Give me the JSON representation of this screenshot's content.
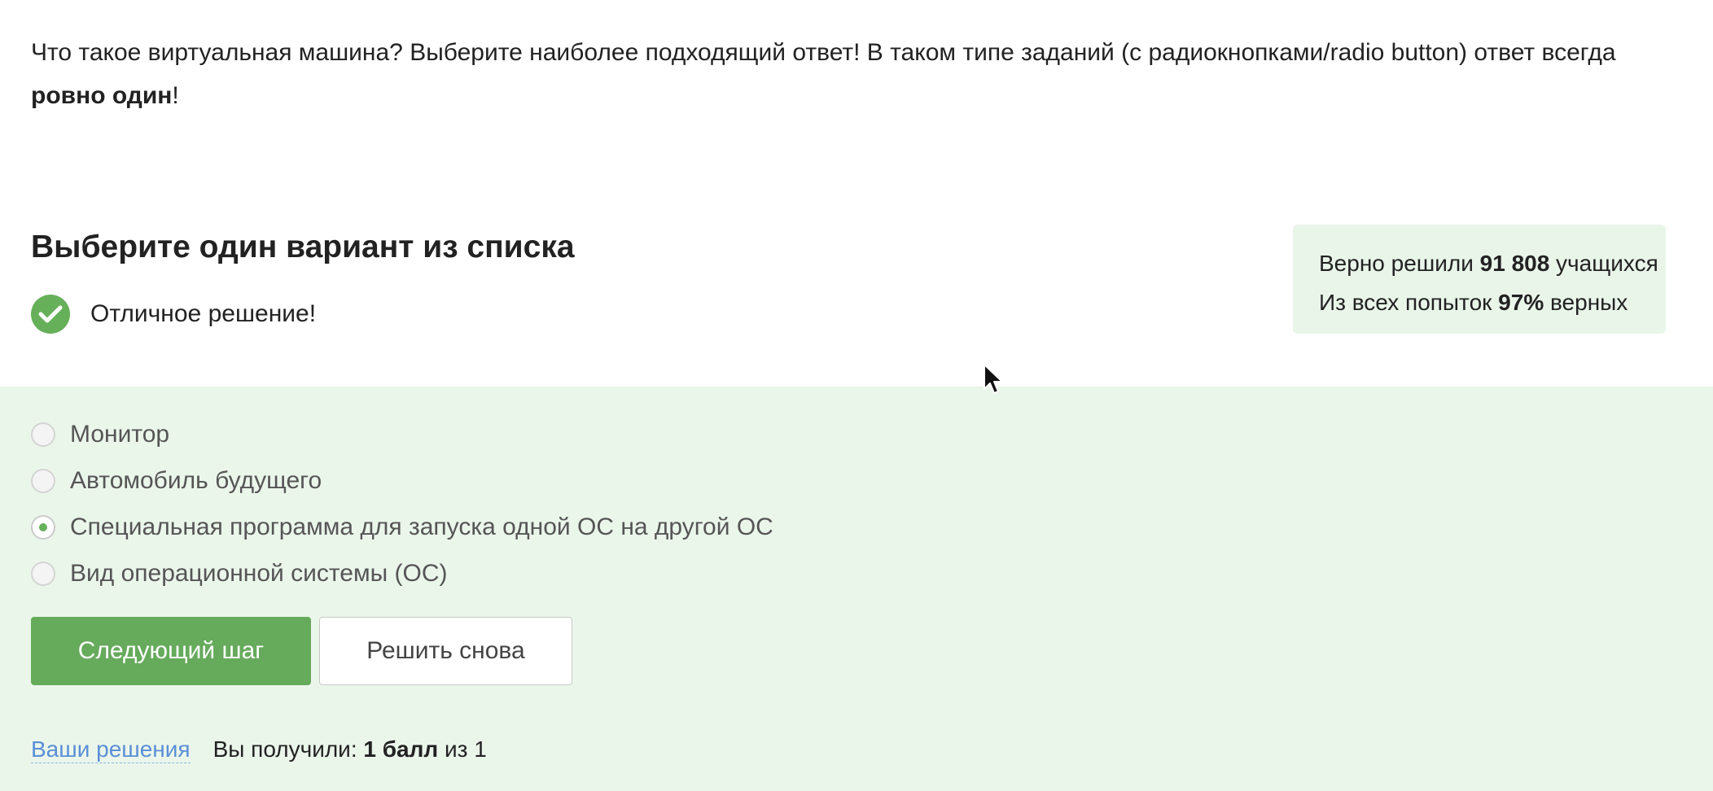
{
  "question": {
    "text_part1": "Что такое виртуальная машина? Выберите наиболее подходящий ответ! В таком типе заданий (с радиокнопками/radio button) ответ всегда ",
    "text_bold": "ровно один",
    "text_part2": "!"
  },
  "quiz": {
    "title": "Выберите один вариант из списка",
    "result_text": "Отличное решение!"
  },
  "stats": {
    "solved_prefix": "Верно решили ",
    "solved_count": "91 808",
    "solved_suffix": " учащихся",
    "attempts_prefix": "Из всех попыток ",
    "attempts_percent": "97%",
    "attempts_suffix": " верных"
  },
  "options": [
    {
      "label": "Монитор",
      "selected": false
    },
    {
      "label": "Автомобиль будущего",
      "selected": false
    },
    {
      "label": "Специальная программа для запуска одной ОС на другой ОС",
      "selected": true
    },
    {
      "label": "Вид операционной системы (ОС)",
      "selected": false
    }
  ],
  "buttons": {
    "next_label": "Следующий шаг",
    "retry_label": "Решить снова"
  },
  "footer": {
    "solutions_link": "Ваши решения",
    "score_prefix": "Вы получили: ",
    "score_value": "1 балл",
    "score_suffix": " из 1"
  },
  "colors": {
    "accent_green": "#66b05a",
    "panel_bg": "#ebf6eb",
    "stats_bg": "#e9f5e9",
    "link_blue": "#5a8fd6"
  }
}
